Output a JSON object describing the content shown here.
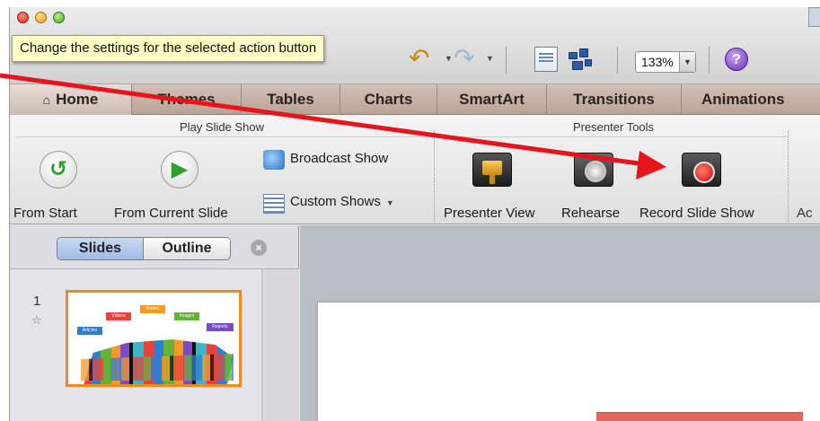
{
  "tooltip": "Change the settings for the selected action button",
  "toolbar": {
    "zoom_value": "133%",
    "help_label": "?",
    "icons": [
      "undo-icon",
      "redo-icon",
      "view-icon",
      "media-browser-icon",
      "help-icon"
    ]
  },
  "tabs": [
    {
      "label": "Home",
      "icon": "home-icon"
    },
    {
      "label": "Themes"
    },
    {
      "label": "Tables"
    },
    {
      "label": "Charts"
    },
    {
      "label": "SmartArt"
    },
    {
      "label": "Transitions"
    },
    {
      "label": "Animations"
    }
  ],
  "ribbon": {
    "play_group": {
      "title": "Play Slide Show",
      "from_start": "From Start",
      "from_current": "From Current Slide",
      "broadcast": "Broadcast Show",
      "custom_shows": "Custom Shows"
    },
    "presenter_group": {
      "title": "Presenter Tools",
      "presenter_view": "Presenter View",
      "rehearse": "Rehearse",
      "record": "Record Slide Show"
    },
    "truncated_label": "Ac"
  },
  "pane": {
    "segments": [
      "Slides",
      "Outline"
    ],
    "active_segment": "Slides",
    "slide_number": "1",
    "thumbnail_labels": [
      "Videos",
      "Books",
      "Images",
      "Articles",
      "Reports"
    ]
  },
  "colors": {
    "annotation_arrow": "#e8141b",
    "thumbnail_border": "#f0891e",
    "tooltip_bg": "#ffffc6"
  }
}
